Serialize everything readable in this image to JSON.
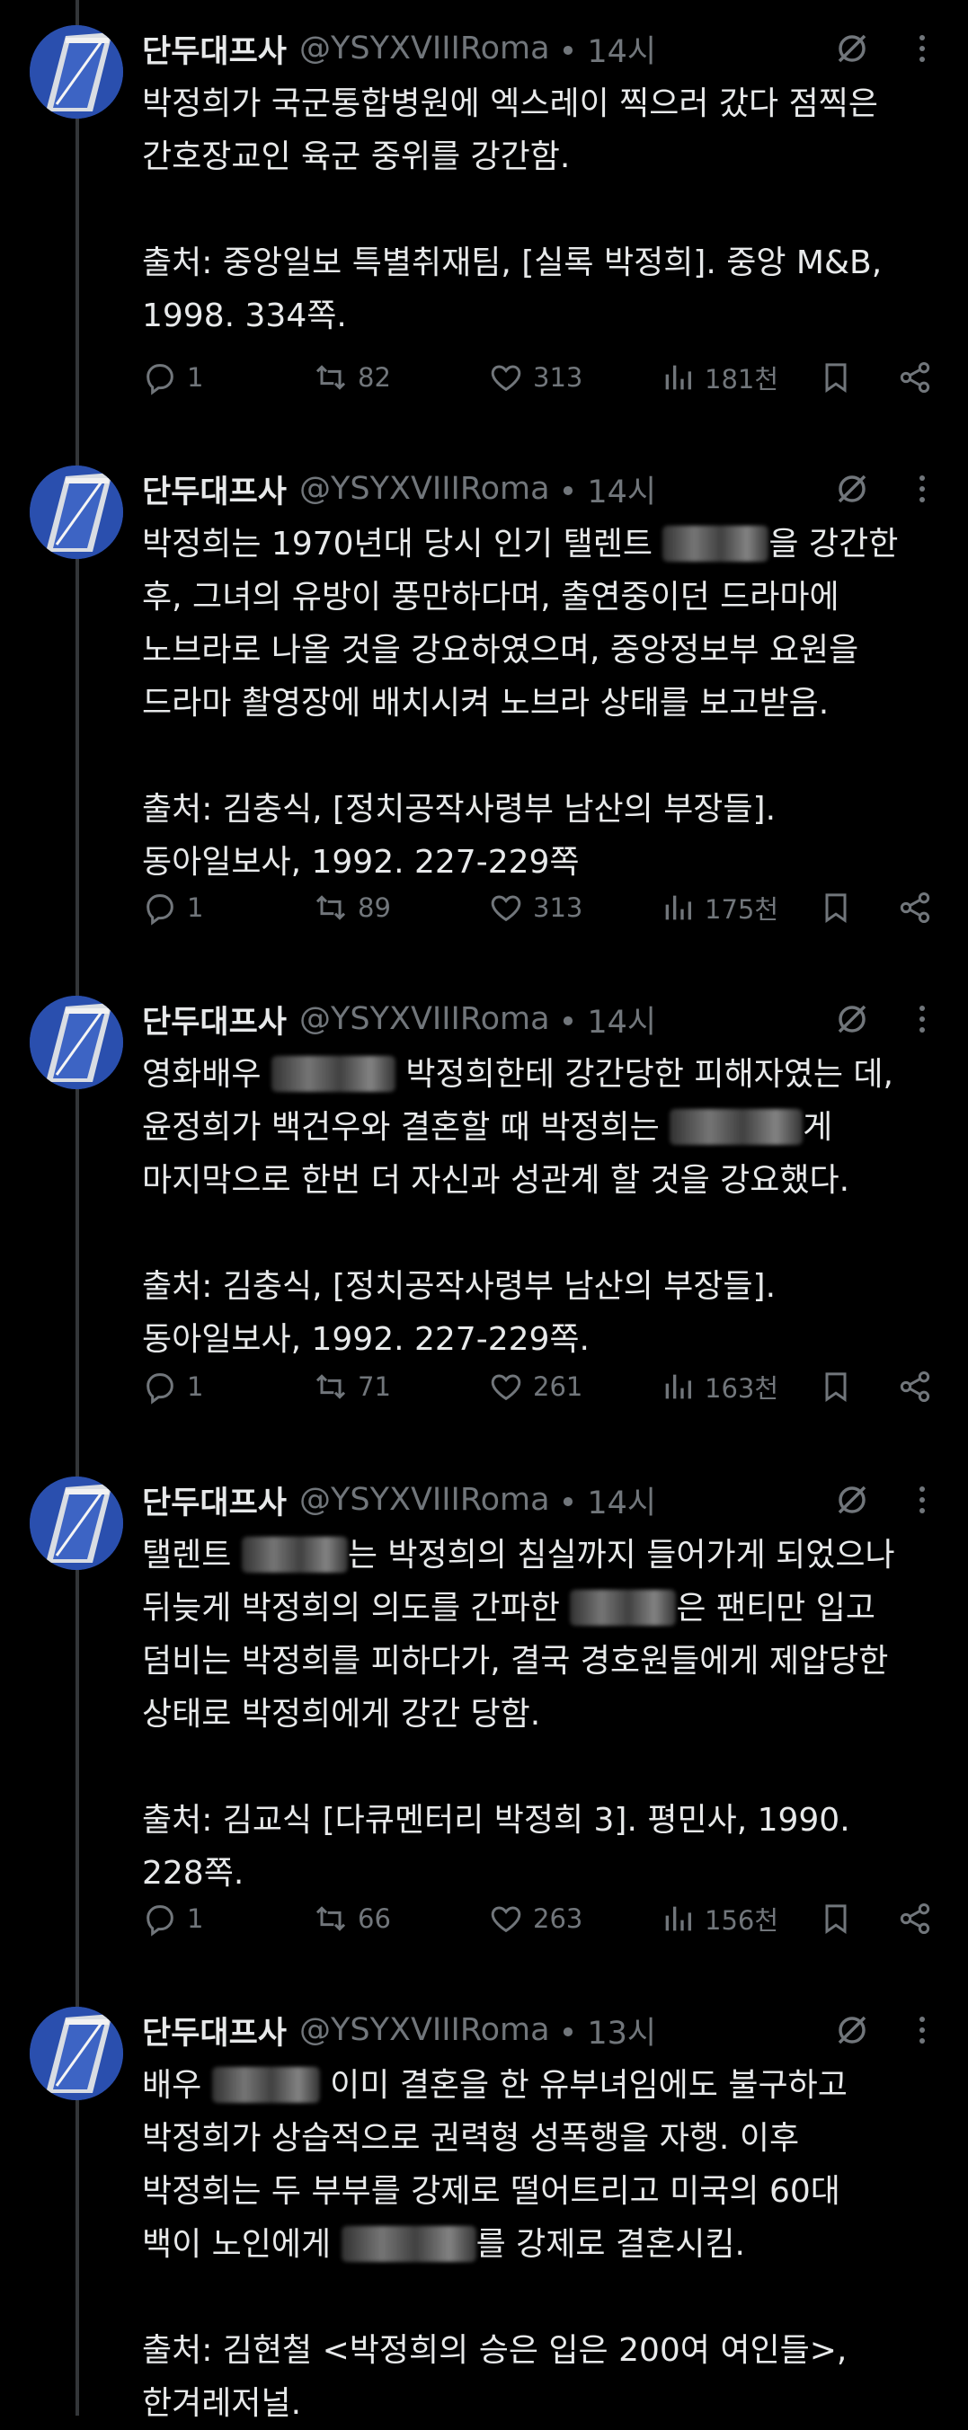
{
  "colors": {
    "background": "#000000",
    "text": "#e7e9ea",
    "secondary": "#71767b"
  },
  "tweets": [
    {
      "author": "단두대프사",
      "handle": "@YSYXVIIIRoma",
      "time": "• 14시",
      "lines": [
        "박정희가 국군통합병원에 엑스레이 찍으러 갔다 점찍은",
        "간호장교인 육군 중위를 강간함.",
        "",
        "출처: 중앙일보 특별취재팀, [실록 박정희]. 중앙 M&B,",
        "1998. 334쪽."
      ],
      "replies": "1",
      "retweets": "82",
      "likes": "313",
      "views": "181천"
    },
    {
      "author": "단두대프사",
      "handle": "@YSYXVIIIRoma",
      "time": "• 14시",
      "lines": [
        "박정희는 1970년대 당시 인기 탤렌트 ",
        "후, 그녀의 유방이 풍만하다며, 출연중이던 드라마에",
        "노브라로 나올 것을 강요하였으며, 중앙정보부 요원을",
        "드라마 촬영장에 배치시켜 노브라 상태를 보고받음.",
        "",
        "출처: 김충식, [정치공작사령부 남산의 부장들].",
        "동아일보사, 1992. 227-229쪽"
      ],
      "line0_suffix": "을 강간한",
      "replies": "1",
      "retweets": "89",
      "likes": "313",
      "views": "175천"
    },
    {
      "author": "단두대프사",
      "handle": "@YSYXVIIIRoma",
      "time": "• 14시",
      "lines": [
        "영화배우 ",
        "윤정희가 백건우와 결혼할 때 박정희는 ",
        "마지막으로 한번 더 자신과 성관계 할 것을 강요했다.",
        "",
        "출처: 김충식, [정치공작사령부 남산의 부장들].",
        "동아일보사, 1992. 227-229쪽."
      ],
      "line0_suffix": " 박정희한테 강간당한 피해자였는 데,",
      "line1_suffix": "게",
      "replies": "1",
      "retweets": "71",
      "likes": "261",
      "views": "163천"
    },
    {
      "author": "단두대프사",
      "handle": "@YSYXVIIIRoma",
      "time": "• 14시",
      "lines": [
        "탤렌트 ",
        "뒤늦게 박정희의 의도를 간파한 ",
        "덤비는 박정희를 피하다가, 결국 경호원들에게 제압당한",
        "상태로 박정희에게 강간 당함.",
        "",
        "출처: 김교식 [다큐멘터리 박정희 3]. 평민사, 1990.",
        "228쪽."
      ],
      "line0_suffix": "는 박정희의 침실까지 들어가게 되었으나",
      "line1_suffix": "은 팬티만 입고",
      "replies": "1",
      "retweets": "66",
      "likes": "263",
      "views": "156천"
    },
    {
      "author": "단두대프사",
      "handle": "@YSYXVIIIRoma",
      "time": "• 13시",
      "lines": [
        "배우 ",
        "박정희가 상습적으로 권력형 성폭행을 자행. 이후",
        "박정희는 두 부부를 강제로 떨어트리고 미국의 60대",
        "백이 노인에게 ",
        "",
        "출처: 김현철 <박정희의 승은 입은 200여 여인들>,",
        "한겨레저널."
      ],
      "line0_suffix": " 이미 결혼을 한 유부녀임에도 불구하고",
      "line3_suffix": "를 강제로 결혼시킴."
    }
  ],
  "icons": {
    "grok": "grok-icon",
    "more": "more-icon",
    "reply": "reply-icon",
    "retweet": "retweet-icon",
    "like": "heart-icon",
    "views": "views-icon",
    "bookmark": "bookmark-icon",
    "share": "share-icon"
  }
}
